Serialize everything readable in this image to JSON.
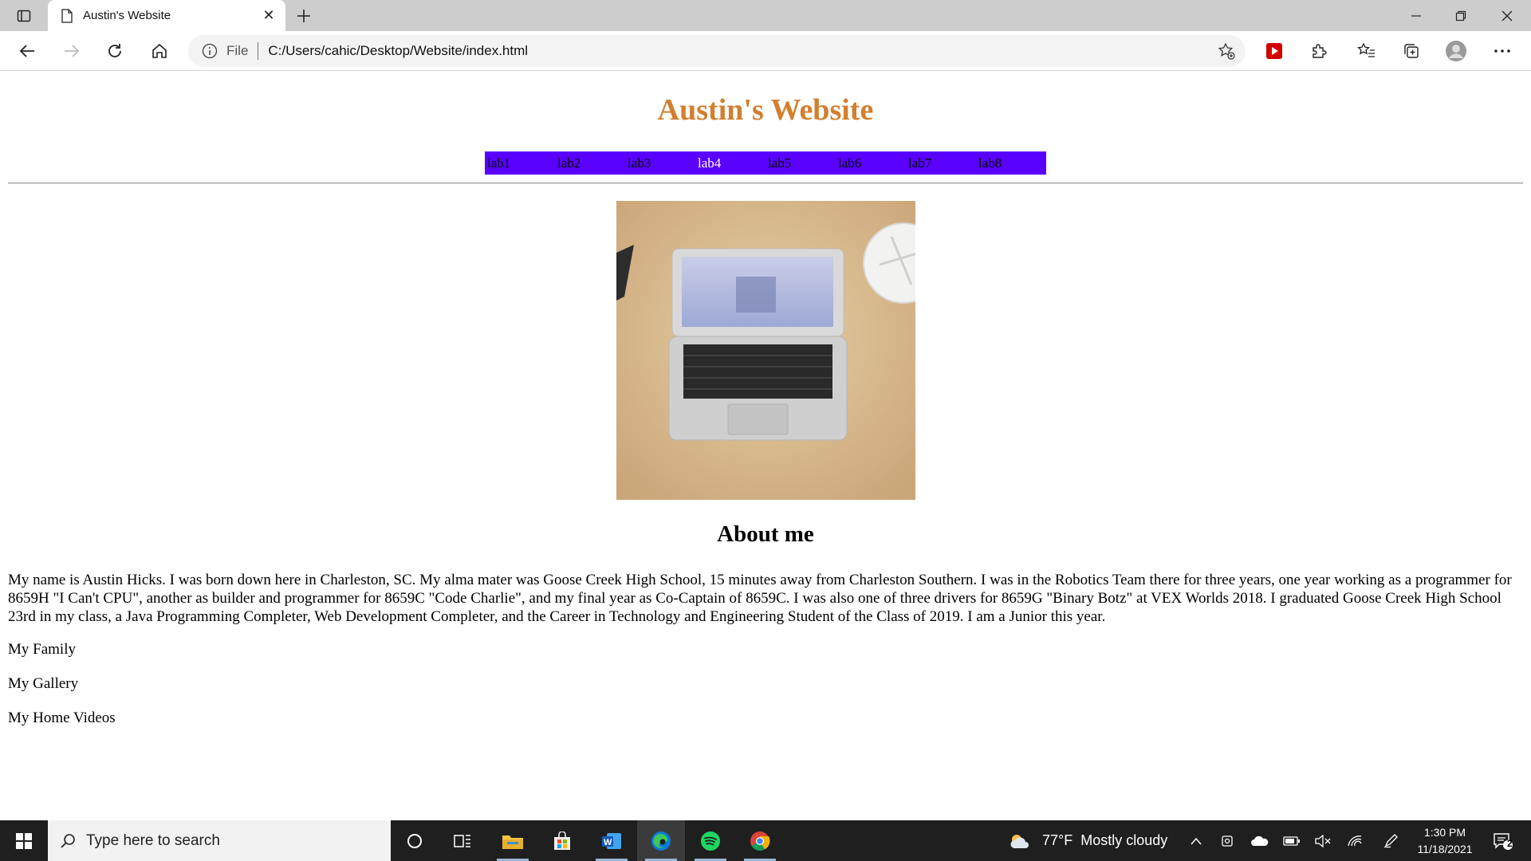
{
  "browser": {
    "tab_title": "Austin's Website",
    "address": {
      "scheme": "File",
      "url": "C:/Users/cahic/Desktop/Website/index.html"
    }
  },
  "page": {
    "site_title": "Austin's Website",
    "nav": [
      {
        "label": "lab1",
        "active": false
      },
      {
        "label": "lab2",
        "active": false
      },
      {
        "label": "lab3",
        "active": false
      },
      {
        "label": "lab4",
        "active": true
      },
      {
        "label": "lab5",
        "active": false
      },
      {
        "label": "lab6",
        "active": false
      },
      {
        "label": "lab7",
        "active": false
      },
      {
        "label": "lab8",
        "active": false
      }
    ],
    "about_heading": "About me",
    "about_text": "My name is Austin Hicks. I was born down here in Charleston, SC. My alma mater was Goose Creek High School, 15 minutes away from Charleston Southern. I was in the Robotics Team there for three years, one year working as a programmer for 8659H \"I Can't CPU\", another as builder and programmer for 8659C \"Code Charlie\", and my final year as Co-Captain of 8659C. I was also one of three drivers for 8659G \"Binary Botz\" at VEX Worlds 2018. I graduated Goose Creek High School 23rd in my class, a Java Programming Completer, Web Development Completer, and the Career in Technology and Engineering Student of the Class of 2019. I am a Junior this year.",
    "links": [
      "My Family",
      "My Gallery",
      "My Home Videos"
    ]
  },
  "taskbar": {
    "search_placeholder": "Type here to search",
    "weather": {
      "temp": "77°F",
      "condition": "Mostly cloudy"
    },
    "time": "1:30 PM",
    "date": "11/18/2021",
    "notification_count": "2"
  },
  "colors": {
    "site_title": "#d27f2f",
    "nav_bg": "#5a00ff",
    "taskbar_bg": "#1f1f1f"
  }
}
